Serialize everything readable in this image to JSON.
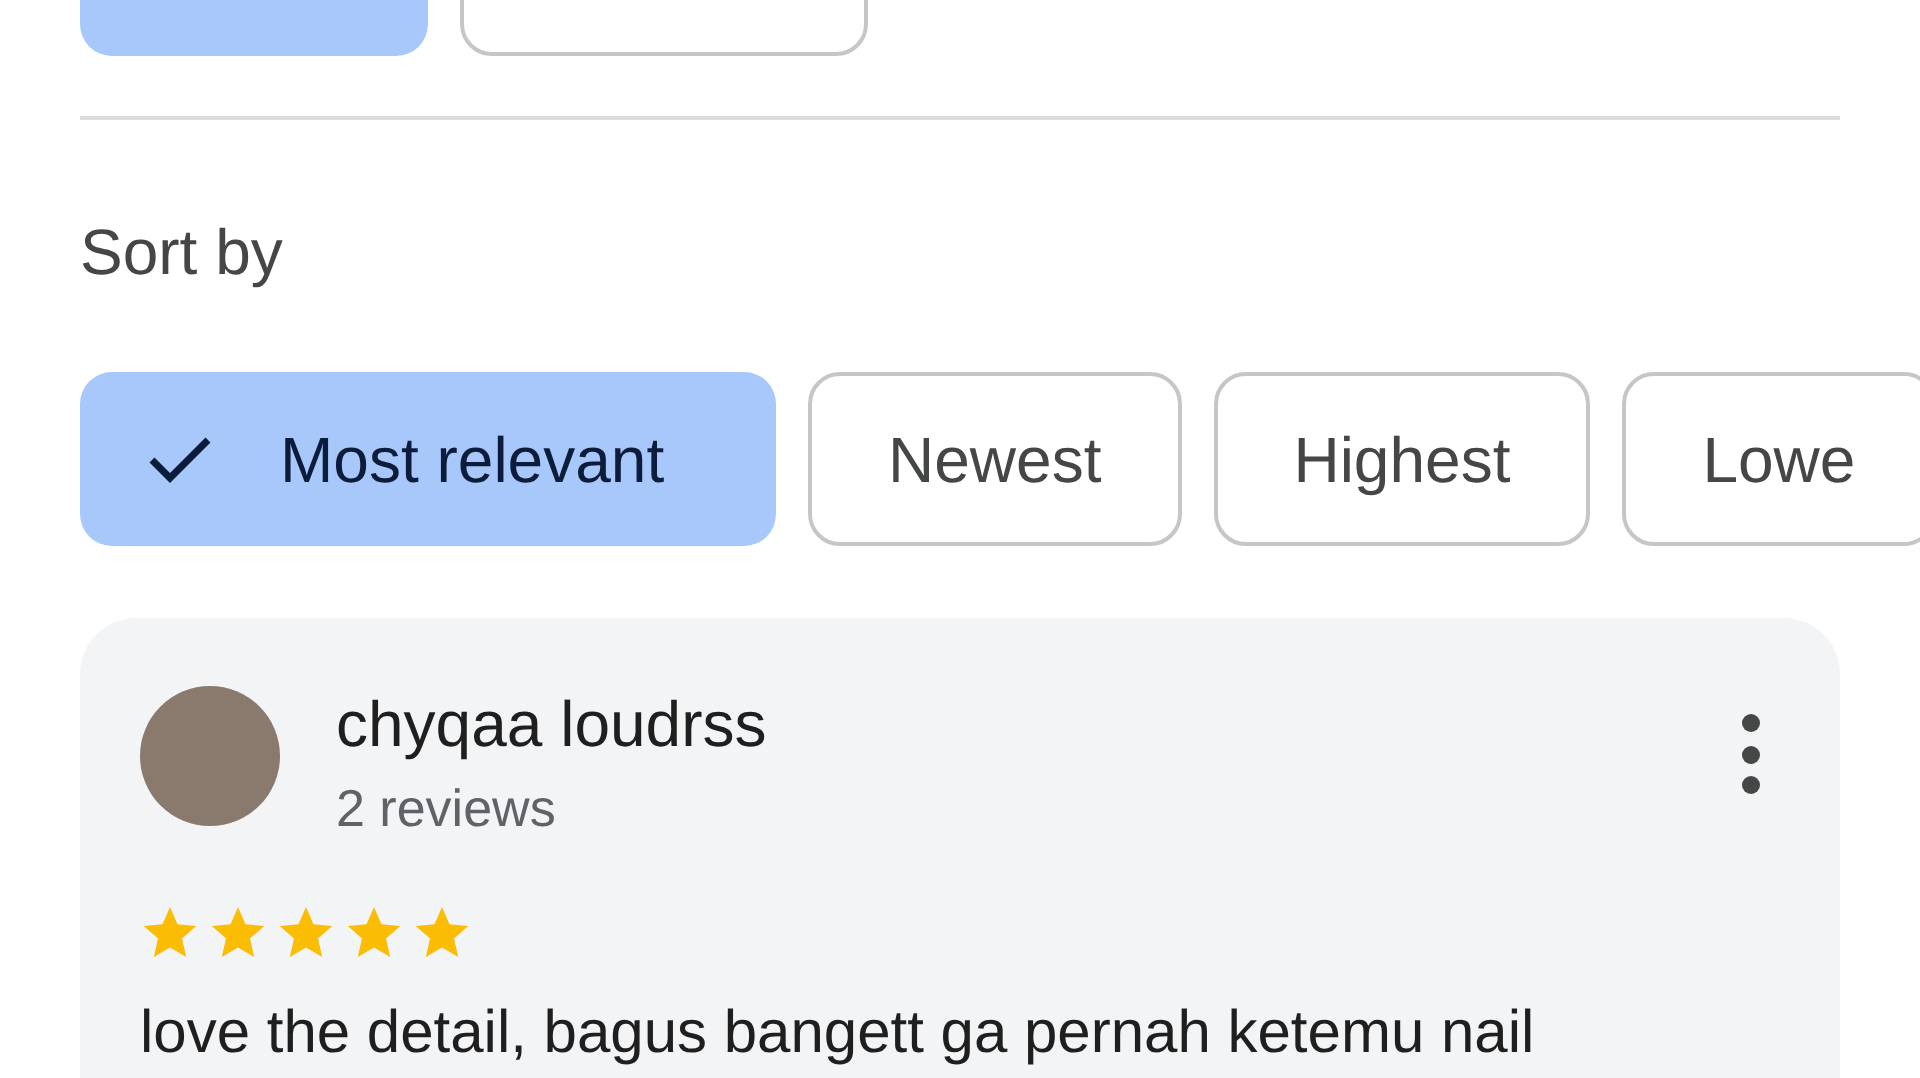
{
  "top_buttons": [
    {
      "selected": true
    },
    {
      "selected": false
    }
  ],
  "sort": {
    "label": "Sort by",
    "options": [
      {
        "label": "Most relevant",
        "selected": true
      },
      {
        "label": "Newest",
        "selected": false
      },
      {
        "label": "Highest",
        "selected": false
      },
      {
        "label": "Lowe",
        "selected": false
      }
    ]
  },
  "review": {
    "author": "chyqaa loudrss",
    "meta": "2 reviews",
    "stars": 5,
    "text": "love the detail, bagus bangett ga pernah ketemu nail"
  }
}
